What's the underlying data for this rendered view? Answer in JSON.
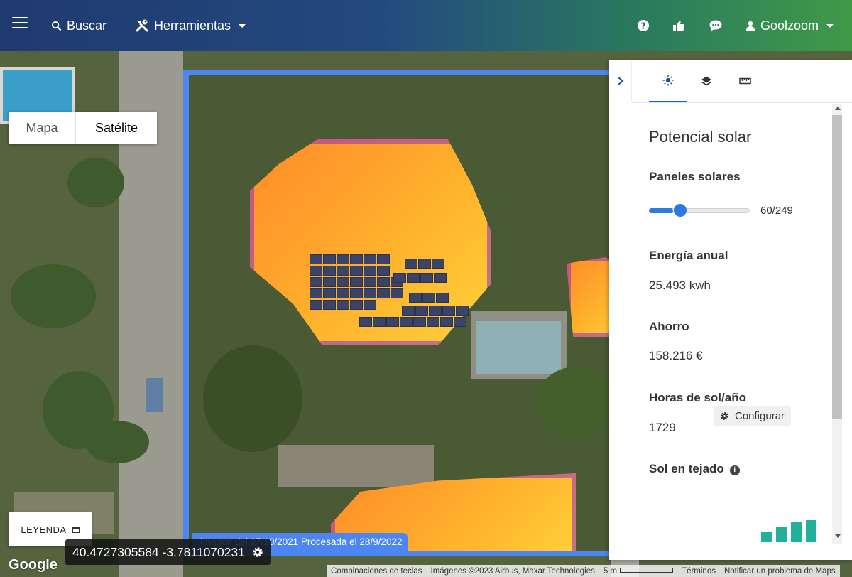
{
  "topbar": {
    "search_label": "Buscar",
    "tools_label": "Herramientas",
    "user_label": "Goolzoom",
    "icons": [
      "menu-icon",
      "search-icon",
      "tools-icon",
      "help-icon",
      "thumbs-up-icon",
      "chat-icon",
      "user-icon"
    ]
  },
  "map": {
    "type_options": [
      "Mapa",
      "Satélite"
    ],
    "selected_type": "Satélite",
    "overlay_caption": "Imagen del 27/10/2021 Procesada el 28/9/2022",
    "legend_label": "LEYENDA",
    "coordinates": "40.4727305584 -3.7811070231",
    "google_logo": "Google",
    "attribution": {
      "shortcuts": "Combinaciones de teclas",
      "imagery": "Imágenes ©2023 Airbus, Maxar Technologies",
      "scale": "5 m",
      "terms": "Términos",
      "report": "Notificar un problema de Maps"
    }
  },
  "panel": {
    "tabs": [
      "sun-icon",
      "layers-icon",
      "ruler-icon"
    ],
    "active_tab": "sun-icon",
    "title": "Potencial solar",
    "panels_label": "Paneles solares",
    "panels_value": "60/249",
    "panels_fraction": 0.241,
    "energy_label": "Energía anual",
    "energy_value": "25.493 kwh",
    "savings_label": "Ahorro",
    "savings_value": "158.216 €",
    "config_label": "Configurar",
    "sun_hours_label": "Horas de sol/año",
    "sun_hours_value": "1729",
    "roof_sun_label": "Sol en tejado"
  },
  "colors": {
    "accent": "#2d7be0",
    "overlay_border": "#4d86f0",
    "teal_bars": "#22b09a"
  }
}
